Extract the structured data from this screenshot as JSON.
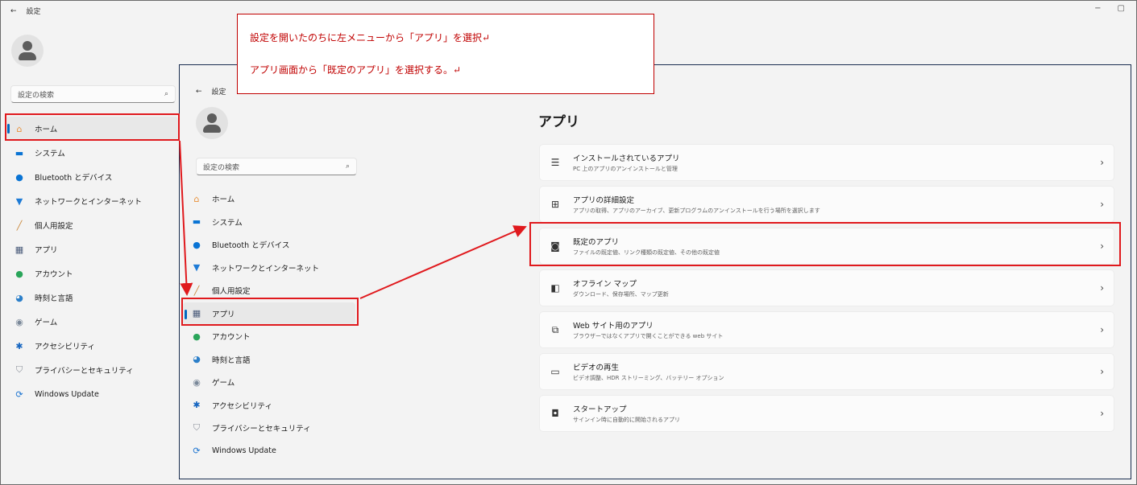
{
  "back_window": {
    "title": "設定",
    "search_placeholder": "設定の検索",
    "nav": [
      {
        "label": "ホーム",
        "icon": "home-icon"
      },
      {
        "label": "システム",
        "icon": "system-icon"
      },
      {
        "label": "Bluetooth とデバイス",
        "icon": "bluetooth-icon"
      },
      {
        "label": "ネットワークとインターネット",
        "icon": "network-icon"
      },
      {
        "label": "個人用設定",
        "icon": "brush-icon"
      },
      {
        "label": "アプリ",
        "icon": "apps-icon"
      },
      {
        "label": "アカウント",
        "icon": "account-icon"
      },
      {
        "label": "時刻と言語",
        "icon": "time-language-icon"
      },
      {
        "label": "ゲーム",
        "icon": "gaming-icon"
      },
      {
        "label": "アクセシビリティ",
        "icon": "accessibility-icon"
      },
      {
        "label": "プライバシーとセキュリティ",
        "icon": "shield-icon"
      },
      {
        "label": "Windows Update",
        "icon": "windows-update-icon"
      }
    ]
  },
  "front_window": {
    "title": "設定",
    "search_placeholder": "設定の検索",
    "nav": [
      {
        "label": "ホーム"
      },
      {
        "label": "システム"
      },
      {
        "label": "Bluetooth とデバイス"
      },
      {
        "label": "ネットワークとインターネット"
      },
      {
        "label": "個人用設定"
      },
      {
        "label": "アプリ"
      },
      {
        "label": "アカウント"
      },
      {
        "label": "時刻と言語"
      },
      {
        "label": "ゲーム"
      },
      {
        "label": "アクセシビリティ"
      },
      {
        "label": "プライバシーとセキュリティ"
      },
      {
        "label": "Windows Update"
      }
    ],
    "page_title": "アプリ",
    "cards": [
      {
        "title": "インストールされているアプリ",
        "subtitle": "PC 上のアプリのアンインストールと管理",
        "icon": "installed-apps-icon"
      },
      {
        "title": "アプリの詳細設定",
        "subtitle": "アプリの取得、アプリのアーカイブ、更新プログラムのアンインストールを行う場所を選択します",
        "icon": "advanced-apps-icon"
      },
      {
        "title": "既定のアプリ",
        "subtitle": "ファイルの既定値、リンク種類の既定値、その他の既定値",
        "icon": "default-apps-icon"
      },
      {
        "title": "オフライン マップ",
        "subtitle": "ダウンロード、保存場所、マップ更新",
        "icon": "offline-maps-icon"
      },
      {
        "title": "Web サイト用のアプリ",
        "subtitle": "ブラウザーではなくアプリで開くことができる web サイト",
        "icon": "web-apps-icon"
      },
      {
        "title": "ビデオの再生",
        "subtitle": "ビデオ調整、HDR ストリーミング、バッテリー オプション",
        "icon": "video-playback-icon"
      },
      {
        "title": "スタートアップ",
        "subtitle": "サインイン時に自動的に開始されるアプリ",
        "icon": "startup-icon"
      }
    ]
  },
  "callout": {
    "line1": "設定を開いたのちに左メニューから「アプリ」を選択↵",
    "line2": "アプリ画面から「既定のアプリ」を選択する。↵"
  },
  "colors": {
    "accent": "#0067c0",
    "annotation_red": "#e0191d"
  }
}
